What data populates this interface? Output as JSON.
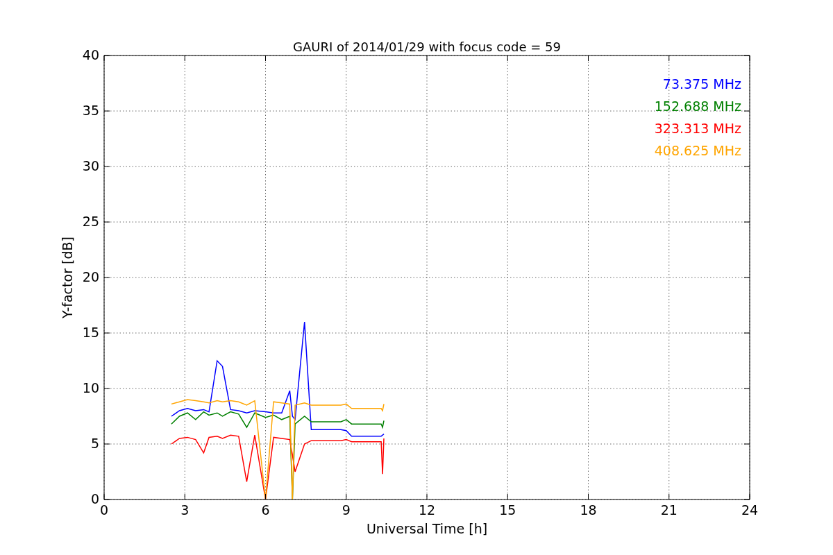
{
  "chart_data": {
    "type": "line",
    "title": "GAURI of 2014/01/29 with focus code = 59",
    "xlabel": "Universal Time [h]",
    "ylabel": "Y-factor [dB]",
    "x": [
      2.5,
      2.8,
      3.1,
      3.4,
      3.7,
      3.9,
      4.2,
      4.4,
      4.7,
      5.0,
      5.3,
      5.6,
      6.0,
      6.3,
      6.6,
      6.9,
      7.0,
      7.1,
      7.45,
      7.7,
      8.8,
      9.0,
      9.2,
      10.3,
      10.35,
      10.4
    ],
    "series": [
      {
        "name": "73.375 MHz",
        "color": "#0000ff",
        "values": [
          7.5,
          8.0,
          8.2,
          8.0,
          8.1,
          7.9,
          12.5,
          12.0,
          8.1,
          8.0,
          7.8,
          8.0,
          7.9,
          7.8,
          7.8,
          9.8,
          7.5,
          7.2,
          16.0,
          6.3,
          6.3,
          6.2,
          5.7,
          5.7,
          5.8,
          5.9
        ]
      },
      {
        "name": "152.688 MHz",
        "color": "#008000",
        "values": [
          6.8,
          7.5,
          7.8,
          7.2,
          7.9,
          7.6,
          7.8,
          7.5,
          7.9,
          7.7,
          6.5,
          7.8,
          7.4,
          7.6,
          7.2,
          7.5,
          0.0,
          6.8,
          7.5,
          7.0,
          7.0,
          7.2,
          6.8,
          6.8,
          6.5,
          7.1
        ]
      },
      {
        "name": "323.313 MHz",
        "color": "#ff0000",
        "values": [
          5.0,
          5.5,
          5.6,
          5.4,
          4.2,
          5.6,
          5.7,
          5.5,
          5.8,
          5.7,
          1.6,
          5.8,
          0.0,
          5.6,
          5.5,
          5.4,
          4.0,
          2.5,
          5.0,
          5.3,
          5.3,
          5.4,
          5.2,
          5.2,
          2.3,
          5.5
        ]
      },
      {
        "name": "408.625 MHz",
        "color": "#ffa500",
        "values": [
          8.6,
          8.8,
          9.0,
          8.9,
          8.8,
          8.7,
          8.9,
          8.8,
          8.9,
          8.8,
          8.5,
          8.9,
          0.0,
          8.8,
          8.7,
          8.6,
          0.0,
          8.5,
          8.7,
          8.5,
          8.5,
          8.6,
          8.2,
          8.2,
          8.0,
          8.6
        ]
      }
    ],
    "grid": true,
    "xlim": [
      0,
      24
    ],
    "ylim": [
      0,
      40
    ],
    "xticks": [
      0,
      3,
      6,
      9,
      12,
      15,
      18,
      21,
      24
    ],
    "yticks": [
      0,
      5,
      10,
      15,
      20,
      25,
      30,
      35,
      40
    ]
  }
}
